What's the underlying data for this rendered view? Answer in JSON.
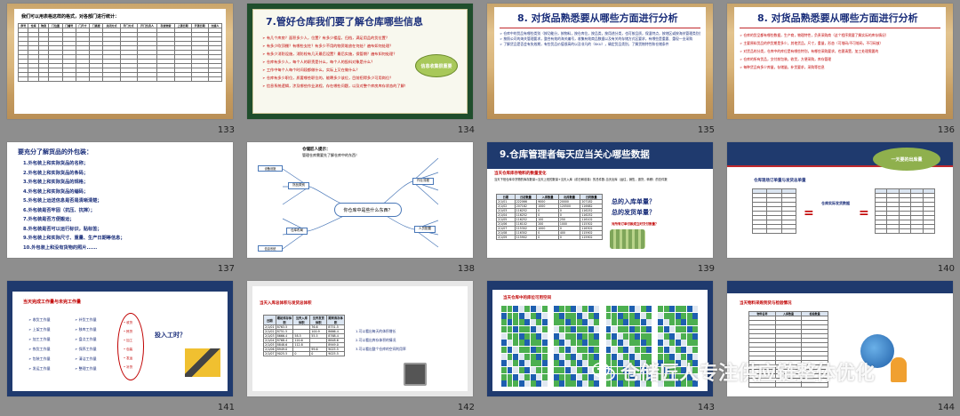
{
  "slides": [
    {
      "num": "133",
      "title": "我们可以用表格这样的格式，对各部门进行统计：",
      "headers": [
        "序号",
        "仓库",
        "物资",
        "门位置",
        "门编号",
        "门尺寸",
        "门高度",
        "关闭方式",
        "开门方式",
        "开门负责人",
        "存放物资",
        "上锁日期",
        "开锁日期",
        "交接人"
      ],
      "rows": 12
    },
    {
      "num": "134",
      "title": "7.管好仓库我们要了解仓库哪些信息",
      "items": [
        "有几个库房？面积多少人，位置？有多少楼层，归档，满足用品的货位置？",
        "有多少吹顶棚？有哪些支柱？有多少不用的物资堆放在何处？遍布如何处理？",
        "有多少消防设施，消防栓有几天最后设置？最后实施，保管期？遍布如何处理？",
        "仓库有多少人，每个人的职责是什么，每个人的投料对象是什么？",
        "工作中每个人每个时间段都做什么，实际上又在做什么？",
        "仓库有多少职位，质要哪些职位的，能聘多少该位，目前招得多少可用岗位？",
        "信息系统逻辑，涉及哪些作业流程，存在哪些问题，以及对整个库房库存状态的了解！"
      ],
      "cloud": "信息收集很重要"
    },
    {
      "num": "135",
      "title": "8. 对货品熟悉要从哪些方面进行分析",
      "items": [
        "仓库中的货品有哪些类别（按功能分，按物料，按仓库位，按品类，按用途分类，也可按品质，保湿特点，按地区或按海关管理类别分，所以需要我们针对具体情况）",
        "按照公司的海关管理要求，整合有效的海关编号，收集有效商品数据以及有关的存储方式区要求，有哪些是重要、重现一业采购",
        "了解货品是否会有失效期，有些货品价值很高的以及非凡的（SKU），确定货品类别，了解货物特性和仓储条件"
      ]
    },
    {
      "num": "136",
      "title": "8. 对货品熟悉要从哪些方面进行分析",
      "items": [
        "仓库的货品都有哪些数据，生产商，物理特性，负责采购商（这个程序需要了解实际的库存情况）",
        "主要原料货品的供货期是多少，其他货品，尺寸，重量，形态（可堆码/不可堆码，不可码放）",
        "对货品的分类，仓库中的库位是有哪些特别，有哪些采购要求，也需清楚，加工处理需要的",
        "仓库的所有货品，交付前包装，收货，方便采购，库存管理",
        "每种货品有多少库量，存储量，补货要求，采购等信息"
      ]
    },
    {
      "num": "137",
      "title": "要充分了解货品的外包装：",
      "items": [
        "1.外包装上和实际货品的名称；",
        "2.外包装上和实际货品的条码；",
        "3.外包装上和实际货品的规格；",
        "4.外包装上和实际货品的编码；",
        "5.外包装上运送信息是否是清晰清楚；",
        "6.外包装是否牢固（抗压、抗摔）；",
        "7.外包装是否方便搬运；",
        "8.外包装是否可以运行标识，贴标签；",
        "9.外包装上和实际尺寸、重量、生产日期等信息；",
        "10.外包装上和没有货物的照片......"
      ]
    },
    {
      "num": "138",
      "title": "仓储匠人提示：",
      "subtitle": "管理仓库需要先了解仓库中的东西！",
      "center": "你仓库中是些什么东西？",
      "branches": [
        "货品类别",
        "仓库布局",
        "作业流程",
        "人员配置",
        "设备设施",
        "信息系统"
      ]
    },
    {
      "num": "139",
      "title": "9.仓库管理者每天应当关心哪些数据",
      "subtitle": "当天仓库库存物料的数量变化",
      "note": "当天下班仓库中货物的库存数量=当天上班的数量+当天入库（前日和前量）的总件数-当天出库（运往，销售，退货，转移）的总件数",
      "cols": [
        "日期",
        "日初数量",
        "入库数量",
        "出库数量",
        "日终数量"
      ],
      "data": [
        [
          "2/1/01",
          "222066",
          "9000",
          "20000",
          "207182"
        ],
        [
          "2/1/02",
          "207182",
          "1000",
          "120500",
          "116682"
        ],
        [
          "2/1/03",
          "116252",
          "0",
          "0",
          "116252"
        ],
        [
          "2/1/04",
          "116252",
          "0",
          "0",
          "116252"
        ],
        [
          "2/1/05",
          "116252",
          "100",
          "250",
          "116102"
        ],
        [
          "2/1/06",
          "116102",
          "200",
          "1000",
          "115302"
        ],
        [
          "2/1/07",
          "115302",
          "1000",
          "0",
          "116302"
        ],
        [
          "2/1/08",
          "116302",
          "0",
          "400",
          "115902"
        ],
        [
          "2/1/09",
          "115902",
          "0",
          "0",
          "115902"
        ]
      ],
      "q1": "总的入库单量？",
      "q2": "总的发货单量？",
      "q3": "对所有订单付款成立时交付数量？"
    },
    {
      "num": "140",
      "title": "仓库现场订单量与发货总单量",
      "bubble": "一天要的出库量",
      "left": "左侧订单",
      "mid": "仓库实际发货数据",
      "right": "发货单量",
      "eq": "="
    },
    {
      "num": "141",
      "title": "当天完成工作量与未完工作量",
      "col1": [
        "收货工作量",
        "上架工作量",
        "加工工作量",
        "拣货工作量",
        "包装工作量",
        "发运工作量"
      ],
      "col2": [
        "补货工作量",
        "移库工作量",
        "盘点工作量",
        "保养工作量",
        "清洁工作量",
        "整理工作量"
      ],
      "oval": [
        "收货",
        "拣货",
        "加工",
        "包装",
        "发运",
        "补货"
      ],
      "ask": "投入工时？"
    },
    {
      "num": "142",
      "title": "当天入库总体积与发货总体积",
      "cols": [
        "日期",
        "期初库存体积",
        "当天入库体积",
        "当天发货体积",
        "期末库存体积"
      ],
      "data": [
        [
          "2/1/01",
          "8763.5",
          "",
          "76.6",
          "8751.5"
        ],
        [
          "2/1/02",
          "8751.5",
          "",
          "100.9",
          "8666.4"
        ],
        [
          "2/1/03",
          "8666.4",
          "58.5",
          "55.5",
          "8768.4"
        ],
        [
          "2/1/04",
          "8768.4",
          "120.6",
          "",
          "8848.6"
        ],
        [
          "2/1/05",
          "8848.6",
          "112.8",
          "",
          "8949.0"
        ],
        [
          "2/1/06",
          "8949.0",
          "",
          "99.6",
          "9025.5"
        ],
        [
          "2/1/07",
          "9025.5",
          "0",
          "0",
          "9025.5"
        ]
      ],
      "notes": [
        "1.可以看出每天的体积增长",
        "2.可以看出库存体积的情况",
        "3.可以看出整个仓库的空间利用率"
      ]
    },
    {
      "num": "143",
      "title": "当天仓库中的库位可用空间"
    },
    {
      "num": "144",
      "title": "当天物料采购到货与检验情况",
      "cols": [
        "物料名称",
        "入库数量",
        "检验数量"
      ],
      "rows": 16
    }
  ],
  "watermark": {
    "icon": "wechat-logo-icon",
    "text": "仓储匠人专注供应链整体优化"
  }
}
